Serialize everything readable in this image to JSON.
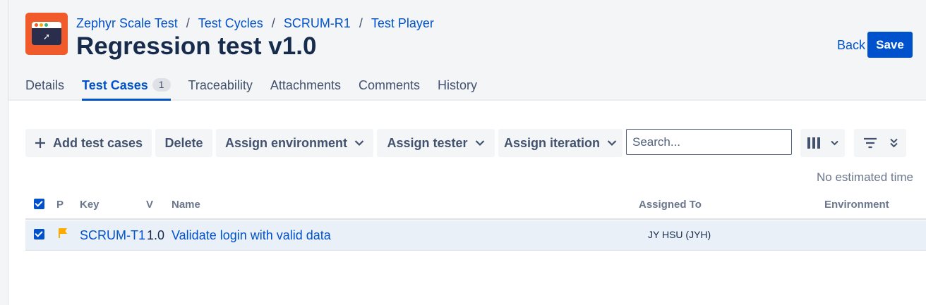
{
  "breadcrumb": [
    {
      "label": "Zephyr Scale Test"
    },
    {
      "label": "Test Cycles"
    },
    {
      "label": "SCRUM-R1"
    },
    {
      "label": "Test Player"
    }
  ],
  "breadcrumb_separator": "/",
  "page_title": "Regression test v1.0",
  "actions": {
    "back_label": "Back",
    "save_label": "Save"
  },
  "tabs": [
    {
      "label": "Details",
      "active": false
    },
    {
      "label": "Test Cases",
      "active": true,
      "count": "1"
    },
    {
      "label": "Traceability",
      "active": false
    },
    {
      "label": "Attachments",
      "active": false
    },
    {
      "label": "Comments",
      "active": false
    },
    {
      "label": "History",
      "active": false
    }
  ],
  "toolbar": {
    "add_label": "Add test cases",
    "delete_label": "Delete",
    "assign_environment_label": "Assign environment",
    "assign_tester_label": "Assign tester",
    "assign_iteration_label": "Assign iteration",
    "search_placeholder": "Search...",
    "columns_icon": "columns-icon",
    "filter_icon": "filter-icon"
  },
  "estimated_time": "No estimated time",
  "table": {
    "columns": {
      "priority": "P",
      "key": "Key",
      "version": "V",
      "name": "Name",
      "assigned_to": "Assigned To",
      "environment": "Environment"
    },
    "select_all_checked": true,
    "rows": [
      {
        "checked": true,
        "priority_icon": "flag-icon",
        "key": "SCRUM-T1",
        "version": "1.0",
        "name": "Validate login with valid data",
        "assigned_to": "JY HSU (JYH)",
        "environment": ""
      }
    ]
  },
  "colors": {
    "accent": "#0052cc",
    "logo": "#f15a2b",
    "priority_flag": "#ffab00",
    "row_selected": "#e9f0f8"
  }
}
